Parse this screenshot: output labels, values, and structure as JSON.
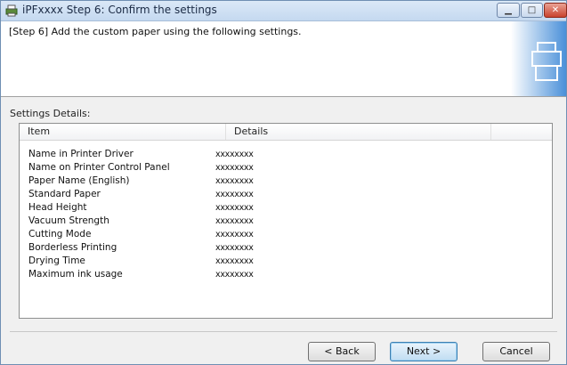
{
  "window": {
    "title": "iPFxxxx Step 6: Confirm the settings"
  },
  "header": {
    "instruction": "[Step 6] Add the custom paper using the following settings."
  },
  "settings": {
    "label": "Settings Details:",
    "columns": [
      "Item",
      "Details"
    ],
    "rows": [
      {
        "item": "Name in Printer Driver",
        "value": "xxxxxxxx"
      },
      {
        "item": "Name on Printer Control Panel",
        "value": "xxxxxxxx"
      },
      {
        "item": "Paper Name (English)",
        "value": "xxxxxxxx"
      },
      {
        "item": "Standard Paper",
        "value": "xxxxxxxx"
      },
      {
        "item": "Head Height",
        "value": "xxxxxxxx"
      },
      {
        "item": "Vacuum Strength",
        "value": "xxxxxxxx"
      },
      {
        "item": "Cutting Mode",
        "value": "xxxxxxxx"
      },
      {
        "item": "Borderless Printing",
        "value": "xxxxxxxx"
      },
      {
        "item": "Drying Time",
        "value": "xxxxxxxx"
      },
      {
        "item": "Maximum ink usage",
        "value": "xxxxxxxx"
      }
    ]
  },
  "buttons": {
    "back": "< Back",
    "next": "Next >",
    "cancel": "Cancel"
  },
  "colors": {
    "accent": "#3c7fb1",
    "titlebar": "#c5d9f0",
    "close": "#c9422d"
  }
}
